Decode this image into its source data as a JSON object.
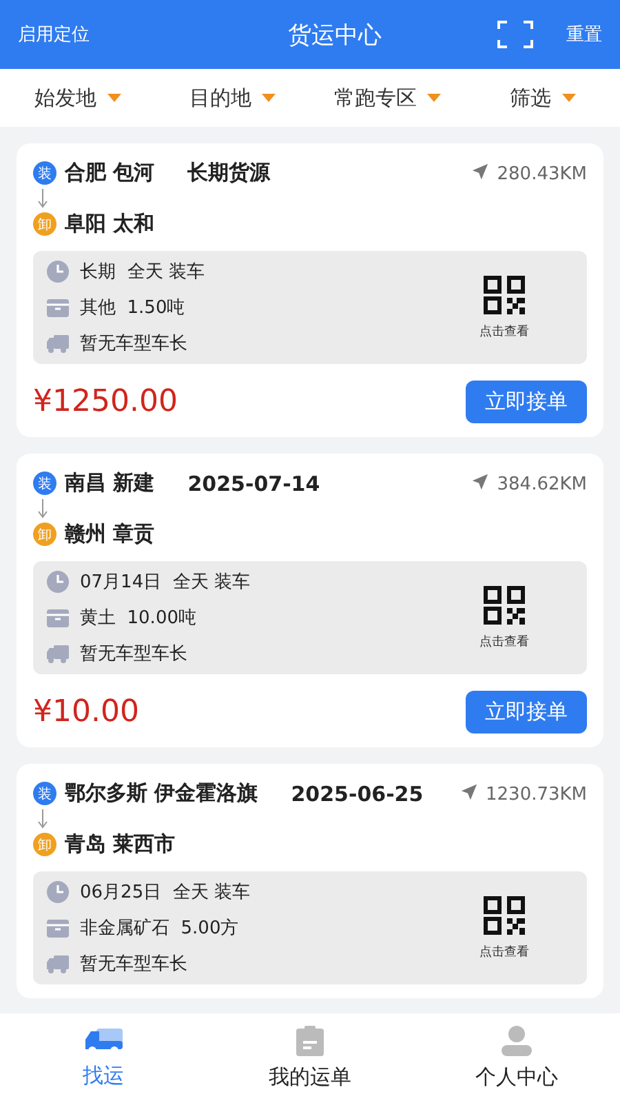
{
  "header": {
    "left": "启用定位",
    "title": "货运中心",
    "right": "重置"
  },
  "filters": [
    "始发地",
    "目的地",
    "常跑专区",
    "筛选"
  ],
  "orders": [
    {
      "load_badge": "装",
      "from": "合肥 包河",
      "tag": "长期货源",
      "distance": "280.43KM",
      "unload_badge": "卸",
      "to": "阜阳 太和",
      "details": [
        {
          "kind": "time",
          "text": "长期  全天 装车"
        },
        {
          "kind": "cargo",
          "text": "其他  1.50吨"
        },
        {
          "kind": "vehicle",
          "text": "暂无车型车长"
        }
      ],
      "qr_label": "点击查看",
      "price": "¥1250.00",
      "action": "立即接单"
    },
    {
      "load_badge": "装",
      "from": "南昌 新建",
      "tag": "2025-07-14",
      "distance": "384.62KM",
      "unload_badge": "卸",
      "to": "赣州 章贡",
      "details": [
        {
          "kind": "time",
          "text": "07月14日  全天 装车"
        },
        {
          "kind": "cargo",
          "text": "黄土  10.00吨"
        },
        {
          "kind": "vehicle",
          "text": "暂无车型车长"
        }
      ],
      "qr_label": "点击查看",
      "price": "¥10.00",
      "action": "立即接单"
    },
    {
      "load_badge": "装",
      "from": "鄂尔多斯 伊金霍洛旗",
      "tag": "2025-06-25",
      "distance": "1230.73KM",
      "unload_badge": "卸",
      "to": "青岛 莱西市",
      "details": [
        {
          "kind": "time",
          "text": "06月25日  全天 装车"
        },
        {
          "kind": "cargo",
          "text": "非金属矿石  5.00方"
        },
        {
          "kind": "vehicle",
          "text": "暂无车型车长"
        }
      ],
      "qr_label": "点击查看"
    }
  ],
  "tabbar": [
    {
      "label": "找运",
      "kind": "truck",
      "selected": true
    },
    {
      "label": "我的运单",
      "kind": "orders",
      "selected": false
    },
    {
      "label": "个人中心",
      "kind": "person",
      "selected": false
    }
  ]
}
